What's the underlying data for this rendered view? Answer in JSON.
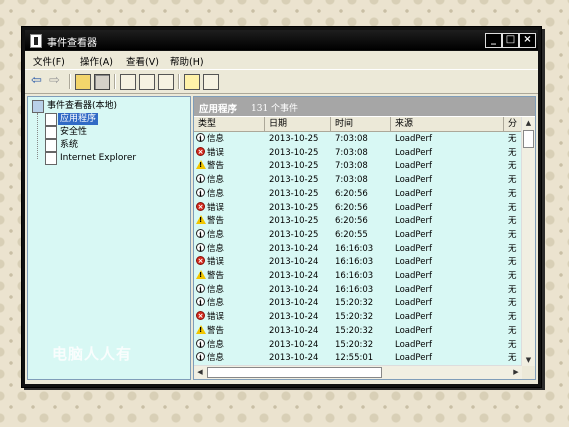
{
  "window": {
    "title": "事件查看器"
  },
  "menus": [
    "文件(F)",
    "操作(A)",
    "查看(V)",
    "帮助(H)"
  ],
  "toolbar_icons": [
    "back-arrow-icon",
    "forward-arrow-icon",
    "folder-up-icon",
    "show-tree-icon",
    "properties-icon",
    "export-icon",
    "refresh-icon",
    "help-icon",
    "view-icon"
  ],
  "tree": {
    "root": "事件查看器(本地)",
    "items": [
      "应用程序",
      "安全性",
      "系统",
      "Internet Explorer"
    ],
    "selected": "应用程序"
  },
  "pane": {
    "title": "应用程序",
    "count": "131 个事件"
  },
  "columns": [
    "类型",
    "日期",
    "时间",
    "来源",
    "分"
  ],
  "rows": [
    {
      "type": "info",
      "type_label": "信息",
      "date": "2013-10-25",
      "time": "7:03:08",
      "source": "LoadPerf",
      "category": "无"
    },
    {
      "type": "error",
      "type_label": "错误",
      "date": "2013-10-25",
      "time": "7:03:08",
      "source": "LoadPerf",
      "category": "无"
    },
    {
      "type": "warn",
      "type_label": "警告",
      "date": "2013-10-25",
      "time": "7:03:08",
      "source": "LoadPerf",
      "category": "无"
    },
    {
      "type": "info",
      "type_label": "信息",
      "date": "2013-10-25",
      "time": "7:03:08",
      "source": "LoadPerf",
      "category": "无"
    },
    {
      "type": "info",
      "type_label": "信息",
      "date": "2013-10-25",
      "time": "6:20:56",
      "source": "LoadPerf",
      "category": "无"
    },
    {
      "type": "error",
      "type_label": "错误",
      "date": "2013-10-25",
      "time": "6:20:56",
      "source": "LoadPerf",
      "category": "无"
    },
    {
      "type": "warn",
      "type_label": "警告",
      "date": "2013-10-25",
      "time": "6:20:56",
      "source": "LoadPerf",
      "category": "无"
    },
    {
      "type": "info",
      "type_label": "信息",
      "date": "2013-10-25",
      "time": "6:20:55",
      "source": "LoadPerf",
      "category": "无"
    },
    {
      "type": "info",
      "type_label": "信息",
      "date": "2013-10-24",
      "time": "16:16:03",
      "source": "LoadPerf",
      "category": "无"
    },
    {
      "type": "error",
      "type_label": "错误",
      "date": "2013-10-24",
      "time": "16:16:03",
      "source": "LoadPerf",
      "category": "无"
    },
    {
      "type": "warn",
      "type_label": "警告",
      "date": "2013-10-24",
      "time": "16:16:03",
      "source": "LoadPerf",
      "category": "无"
    },
    {
      "type": "info",
      "type_label": "信息",
      "date": "2013-10-24",
      "time": "16:16:03",
      "source": "LoadPerf",
      "category": "无"
    },
    {
      "type": "info",
      "type_label": "信息",
      "date": "2013-10-24",
      "time": "15:20:32",
      "source": "LoadPerf",
      "category": "无"
    },
    {
      "type": "error",
      "type_label": "错误",
      "date": "2013-10-24",
      "time": "15:20:32",
      "source": "LoadPerf",
      "category": "无"
    },
    {
      "type": "warn",
      "type_label": "警告",
      "date": "2013-10-24",
      "time": "15:20:32",
      "source": "LoadPerf",
      "category": "无"
    },
    {
      "type": "info",
      "type_label": "信息",
      "date": "2013-10-24",
      "time": "15:20:32",
      "source": "LoadPerf",
      "category": "无"
    },
    {
      "type": "info",
      "type_label": "信息",
      "date": "2013-10-24",
      "time": "12:55:01",
      "source": "LoadPerf",
      "category": "无"
    }
  ],
  "watermark": "电脑人人有",
  "colors": {
    "selection": "#316ac5",
    "list_bg": "#d8f8f4",
    "header_bg": "#a6a6a6",
    "error": "#d42a1e",
    "warning": "#f2c600"
  }
}
